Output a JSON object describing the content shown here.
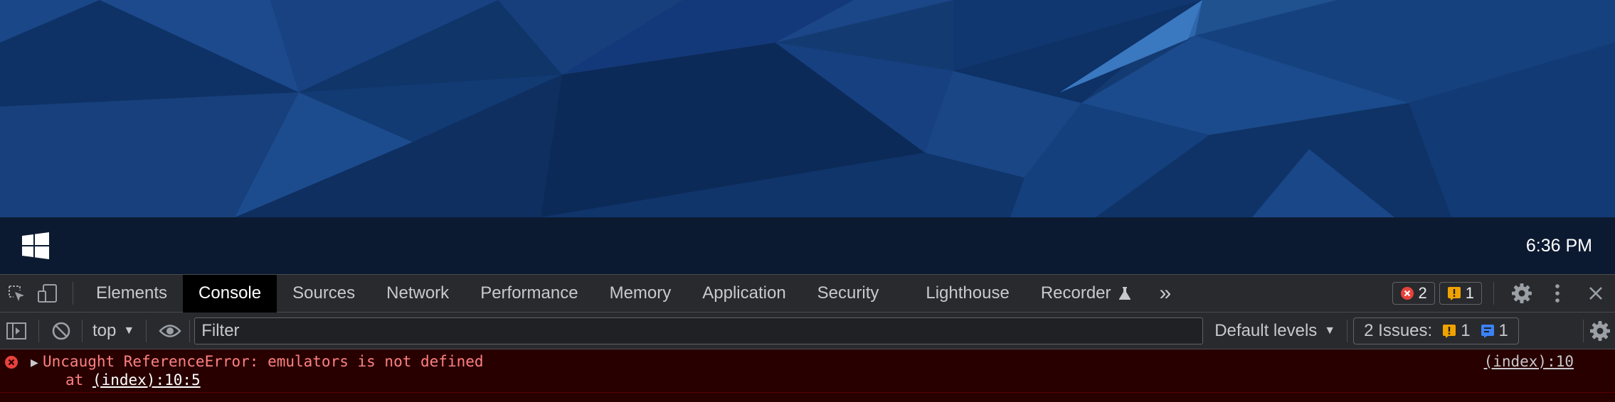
{
  "desktop": {
    "wallpaper_colors": [
      "#0d2d5a",
      "#123a72",
      "#1a4a8a",
      "#235a9e",
      "#3a78c0"
    ],
    "taskbar": {
      "start_icon": "windows-logo-icon",
      "clock": "6:36 PM"
    }
  },
  "devtools": {
    "main_tabs": [
      {
        "label": "Elements"
      },
      {
        "label": "Console",
        "active": true
      },
      {
        "label": "Sources"
      },
      {
        "label": "Network"
      },
      {
        "label": "Performance"
      },
      {
        "label": "Memory"
      },
      {
        "label": "Application"
      },
      {
        "label": "Security"
      },
      {
        "label": "Lighthouse"
      },
      {
        "label": "Recorder",
        "icon": "flask-icon"
      }
    ],
    "more_tabs": "»",
    "error_count": "2",
    "warning_count": "1",
    "toolbar": {
      "context": "top",
      "filter_placeholder": "Filter",
      "levels": "Default levels",
      "issues_label": "2 Issues:",
      "issues_warning_count": "1",
      "issues_info_count": "1"
    },
    "console_messages": [
      {
        "level": "error",
        "text": "Uncaught ReferenceError: emulators is not defined",
        "stack_prefix": "at",
        "stack_location": "(index):10:5",
        "source": "(index):10"
      }
    ],
    "colors": {
      "error_red": "#e8423b",
      "warning_yellow": "#f0a300",
      "info_blue": "#3b82f6"
    }
  }
}
